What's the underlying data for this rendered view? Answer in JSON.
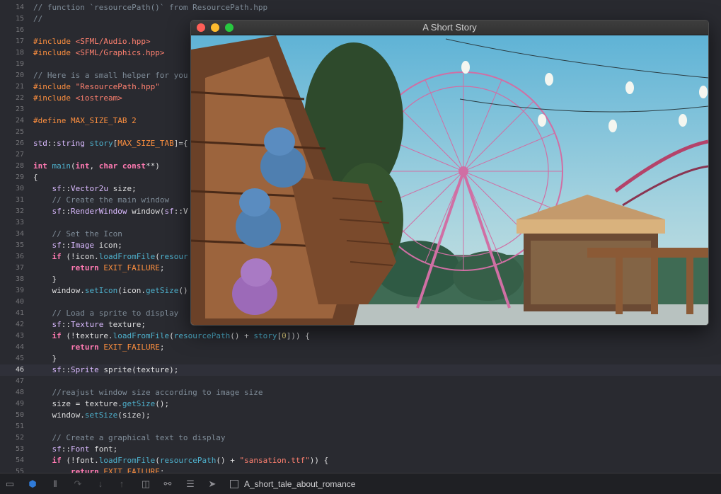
{
  "editor": {
    "lines": [
      {
        "n": "14",
        "html": "<span class='t-comment'>// function `resourcePath()` from ResourcePath.hpp</span>"
      },
      {
        "n": "15",
        "html": "<span class='t-comment'>//</span>"
      },
      {
        "n": "16",
        "html": ""
      },
      {
        "n": "17",
        "html": "<span class='t-pre'>#include </span><span class='t-str'>&lt;SFML/Audio.hpp&gt;</span>"
      },
      {
        "n": "18",
        "html": "<span class='t-pre'>#include </span><span class='t-str'>&lt;SFML/Graphics.hpp&gt;</span>"
      },
      {
        "n": "19",
        "html": ""
      },
      {
        "n": "20",
        "html": "<span class='t-comment'>// Here is a small helper for you</span>"
      },
      {
        "n": "21",
        "html": "<span class='t-pre'>#include </span><span class='t-str'>\"ResourcePath.hpp\"</span>"
      },
      {
        "n": "22",
        "html": "<span class='t-pre'>#include </span><span class='t-str'>&lt;iostream&gt;</span>"
      },
      {
        "n": "23",
        "html": ""
      },
      {
        "n": "24",
        "html": "<span class='t-pre'>#define MAX_SIZE_TAB 2</span>"
      },
      {
        "n": "25",
        "html": ""
      },
      {
        "n": "26",
        "html": "<span class='t-type'>std</span>::<span class='t-type'>string</span> <span class='t-fn'>story</span>[<span class='t-pre'>MAX_SIZE_TAB</span>]={"
      },
      {
        "n": "27",
        "html": ""
      },
      {
        "n": "28",
        "html": "<span class='t-kw'>int</span> <span class='t-fn'>main</span>(<span class='t-kw'>int</span>, <span class='t-kw'>char</span> <span class='t-kw'>const</span>**)"
      },
      {
        "n": "29",
        "html": "{"
      },
      {
        "n": "30",
        "html": "    <span class='t-type'>sf</span>::<span class='t-type'>Vector2u</span> size;"
      },
      {
        "n": "31",
        "html": "    <span class='t-comment'>// Create the main window</span>"
      },
      {
        "n": "32",
        "html": "    <span class='t-type'>sf</span>::<span class='t-type'>RenderWindow</span> window(<span class='t-type'>sf</span>::V"
      },
      {
        "n": "33",
        "html": ""
      },
      {
        "n": "34",
        "html": "    <span class='t-comment'>// Set the Icon</span>"
      },
      {
        "n": "35",
        "html": "    <span class='t-type'>sf</span>::<span class='t-type'>Image</span> icon;"
      },
      {
        "n": "36",
        "html": "    <span class='t-kw'>if</span> (!icon.<span class='t-fn'>loadFromFile</span>(<span class='t-fn'>resour</span>"
      },
      {
        "n": "37",
        "html": "        <span class='t-kw'>return</span> <span class='t-pre'>EXIT_FAILURE</span>;"
      },
      {
        "n": "38",
        "html": "    }"
      },
      {
        "n": "39",
        "html": "    window.<span class='t-fn'>setIcon</span>(icon.<span class='t-fn'>getSize</span>()"
      },
      {
        "n": "40",
        "html": ""
      },
      {
        "n": "41",
        "html": "    <span class='t-comment'>// Load a sprite to display</span>"
      },
      {
        "n": "42",
        "html": "    <span class='t-type'>sf</span>::<span class='t-type'>Texture</span> texture;"
      },
      {
        "n": "43",
        "html": "    <span class='t-kw'>if</span> (!texture.<span class='t-fn'>loadFromFile</span>(<span class='t-fn'>resourcePath</span>() + <span class='t-fn'>story</span>[<span class='t-num'>0</span>])) {"
      },
      {
        "n": "44",
        "html": "        <span class='t-kw'>return</span> <span class='t-pre'>EXIT_FAILURE</span>;"
      },
      {
        "n": "45",
        "html": "    }"
      },
      {
        "n": "46",
        "html": "    <span class='t-type'>sf</span>::<span class='t-type'>Sprite</span> sprite(texture);"
      },
      {
        "n": "47",
        "html": ""
      },
      {
        "n": "48",
        "html": "    <span class='t-comment'>//reajust window size according to image size</span>"
      },
      {
        "n": "49",
        "html": "    size = texture.<span class='t-fn'>getSize</span>();"
      },
      {
        "n": "50",
        "html": "    window.<span class='t-fn'>setSize</span>(size);"
      },
      {
        "n": "51",
        "html": ""
      },
      {
        "n": "52",
        "html": "    <span class='t-comment'>// Create a graphical text to display</span>"
      },
      {
        "n": "53",
        "html": "    <span class='t-type'>sf</span>::<span class='t-type'>Font</span> font;"
      },
      {
        "n": "54",
        "html": "    <span class='t-kw'>if</span> (!font.<span class='t-fn'>loadFromFile</span>(<span class='t-fn'>resourcePath</span>() + <span class='t-str'>\"sansation.ttf\"</span>)) {"
      },
      {
        "n": "55",
        "html": "        <span class='t-kw'>return</span> <span class='t-pre'>EXIT_FAILURE</span>;"
      }
    ],
    "current_line": "46"
  },
  "window": {
    "title": "A Short Story"
  },
  "statusbar": {
    "target_label": "A_short_tale_about_romance",
    "icons": [
      "hide-panel-icon",
      "breakpoints-icon",
      "pause-icon",
      "step-over-icon",
      "step-into-icon",
      "step-out-icon",
      "view-debugger-icon",
      "memory-graph-icon",
      "environment-icon",
      "location-icon",
      "target-checkbox-icon"
    ]
  },
  "colors": {
    "background": "#292a30",
    "comment": "#7f8c98",
    "keyword": "#ff7ab2",
    "preprocessor": "#fd8f3f",
    "string": "#ff8170",
    "type": "#dabaff",
    "function": "#4eb0cc",
    "accent": "#2f7bd9"
  }
}
